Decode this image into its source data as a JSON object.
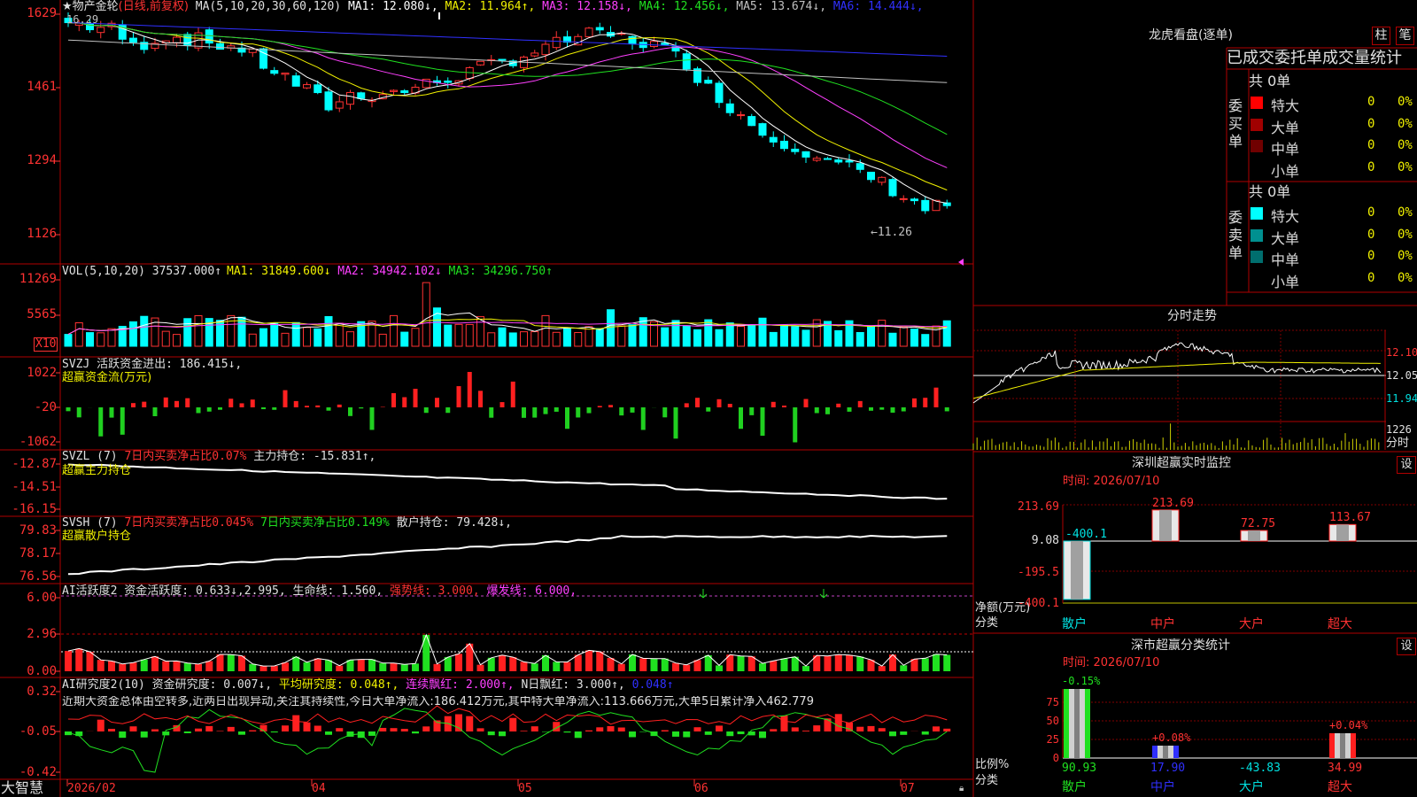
{
  "main": {
    "title": "★物产金轮",
    "period": "(日线,前复权)",
    "ma_label": "MA(5,10,20,30,60,120)",
    "ma": [
      {
        "name": "MA1:",
        "value": "12.080↓",
        "color": "#ffffff"
      },
      {
        "name": "MA2:",
        "value": "11.964↑",
        "color": "#f0f000"
      },
      {
        "name": "MA3:",
        "value": "12.158↓",
        "color": "#ff40ff"
      },
      {
        "name": "MA4:",
        "value": "12.456↓",
        "color": "#20e020"
      },
      {
        "name": "MA5:",
        "value": "13.674↓",
        "color": "#c0c0c0"
      },
      {
        "name": "MA6:",
        "value": "14.444↓",
        "color": "#3030ff"
      }
    ],
    "ticks": [
      "1629",
      "1461",
      "1294",
      "1126"
    ],
    "high_note": "16.29",
    "low_note": "←11.26"
  },
  "vol": {
    "label": "VOL(5,10,20)",
    "value": "37537.000↑",
    "ma1": "MA1: 31849.600↓",
    "ma2": "MA2: 34942.102↓",
    "ma3": "MA3: 34296.750↑",
    "ticks": [
      "11269",
      "5565"
    ],
    "unit": "X10"
  },
  "svzj": {
    "label": "SVZJ  活跃资金进出: 186.415↓,",
    "sub": "超赢资金流(万元)",
    "ticks": [
      "1022",
      "-20",
      "-1062"
    ]
  },
  "svzl": {
    "l1": "SVZL (7)",
    "l2": "7日内买卖净占比0.07%",
    "l3": "主力持仓: -15.831↑,",
    "sub": "超赢主力持仓",
    "ticks": [
      "-12.87",
      "-14.51",
      "-16.15"
    ]
  },
  "svsh": {
    "l1": "SVSH (7)",
    "l2": "7日内买卖净占比0.045%",
    "l3": "7日内买卖净占比0.149%",
    "l4": "散户持仓: 79.428↓,",
    "sub": "超赢散户持仓",
    "ticks": [
      "79.83",
      "78.17",
      "76.56"
    ]
  },
  "ai1": {
    "l1": "AI活跃度2 资金活跃度: 0.633↓,",
    "l2": "2.995,",
    "l3": "生命线: 1.560,",
    "l4": "强势线: 3.000,",
    "l5": "爆发线: 6.000,",
    "ticks": [
      "6.00",
      "2.96",
      "0.00"
    ]
  },
  "ai2": {
    "l1": "AI研究度2(10) 资金研究度: 0.007↓,",
    "l2": "平均研究度: 0.048↑,",
    "l3": "连续飘红: 2.000↑,",
    "l4": "N日飘红: 3.000↑,",
    "l5": "0.048↑",
    "text": "近期大资金总体由空转多,近两日出现异动,关注其持续性,今日大单净流入:186.412万元,其中特大单净流入:113.666万元,大单5日累计净入462.779",
    "ticks": [
      "0.32",
      "-0.05",
      "-0.42"
    ]
  },
  "xaxis": {
    "logo": "大智慧",
    "months": [
      "2026/02",
      "04",
      "05",
      "06",
      "07"
    ]
  },
  "lh": {
    "title": "龙虎看盘(逐单)",
    "btn1": "柱",
    "btn2": "笔",
    "header": "已成交委托单成交量统计",
    "buy": {
      "side": "委买单",
      "total": "共 0单",
      "rows": [
        {
          "name": "特大",
          "color": "#ff0000",
          "v1": "0",
          "v2": "0%"
        },
        {
          "name": "大单",
          "color": "#a00000",
          "v1": "0",
          "v2": "0%"
        },
        {
          "name": "中单",
          "color": "#700000",
          "v1": "0",
          "v2": "0%"
        },
        {
          "name": "小单",
          "color": "",
          "v1": "0",
          "v2": "0%"
        }
      ]
    },
    "sell": {
      "side": "委卖单",
      "total": "共 0单",
      "rows": [
        {
          "name": "特大",
          "color": "#00ffff",
          "v1": "0",
          "v2": "0%"
        },
        {
          "name": "大单",
          "color": "#009090",
          "v1": "0",
          "v2": "0%"
        },
        {
          "name": "中单",
          "color": "#006e6e",
          "v1": "0",
          "v2": "0%"
        },
        {
          "name": "小单",
          "color": "",
          "v1": "0",
          "v2": "0%"
        }
      ]
    }
  },
  "fs": {
    "title": "分时走势",
    "ticks": [
      "12.10",
      "12.05",
      "11.94",
      "1226",
      "分时"
    ]
  },
  "sz": {
    "title": "深圳超赢实时监控",
    "btn": "设",
    "time": "时间: 2026/07/10",
    "ticks": [
      "213.69",
      "9.08",
      "-195.5",
      "-400.1"
    ],
    "ylabel": "净额(万元)",
    "xlabel": "分类",
    "bars": [
      {
        "name": "散户",
        "value": "-400.1",
        "num": -400.1
      },
      {
        "name": "中户",
        "value": "213.69",
        "num": 213.69
      },
      {
        "name": "大户",
        "value": "72.75",
        "num": 72.75
      },
      {
        "name": "超大",
        "value": "113.67",
        "num": 113.67
      }
    ]
  },
  "sc": {
    "title": "深市超赢分类统计",
    "btn": "设",
    "time": "时间: 2026/07/10",
    "ticks": [
      "75",
      "50",
      "25",
      "0"
    ],
    "ylabel": "比例%",
    "xlabel": "分类",
    "bars": [
      {
        "name": "散户",
        "pct": "-0.15%",
        "value": "90.93",
        "num": 90.93
      },
      {
        "name": "中户",
        "pct": "+0.08%",
        "value": "17.90",
        "num": 17.9
      },
      {
        "name": "大户",
        "pct": "",
        "value": "-43.83",
        "num": -43.83
      },
      {
        "name": "超大",
        "pct": "+0.04%",
        "value": "34.99",
        "num": 34.99
      }
    ]
  }
}
